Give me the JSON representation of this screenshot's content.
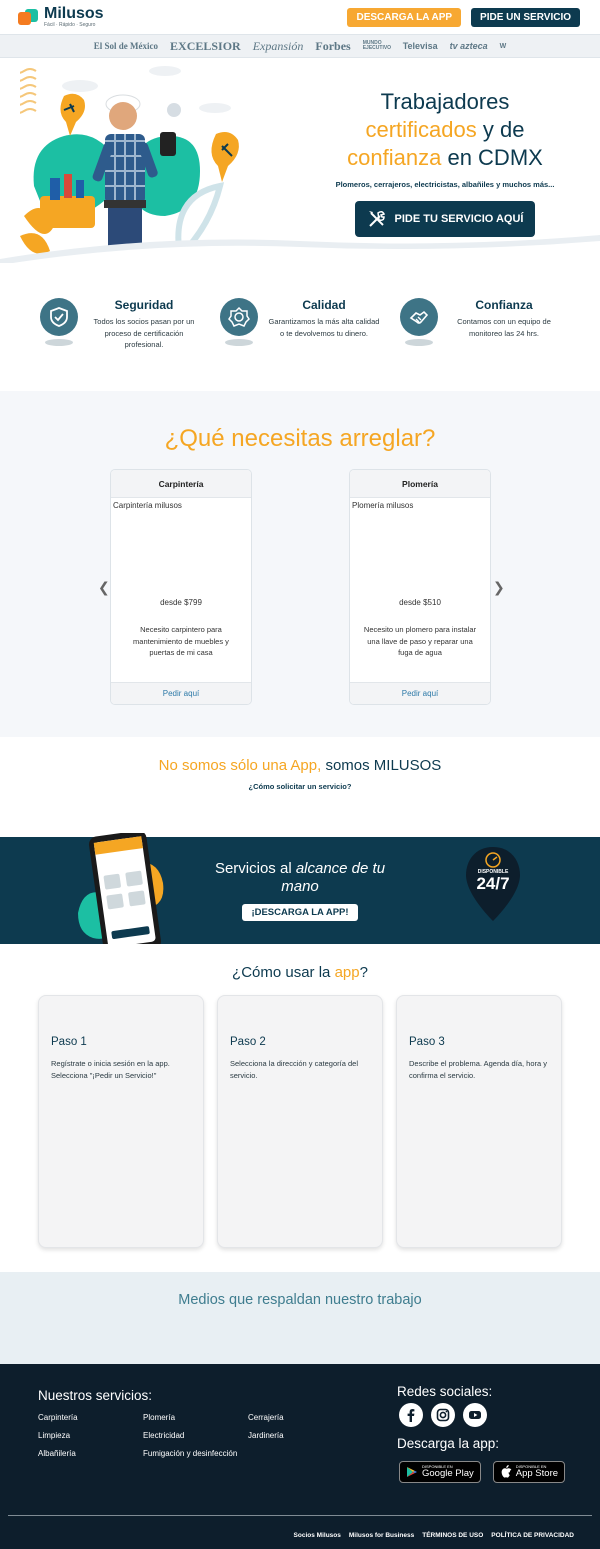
{
  "header": {
    "logo_name": "Milusos",
    "logo_tagline": "Fácil · Rápido · Seguro",
    "download_btn": "DESCARGA LA APP",
    "service_btn": "PIDE UN SERVICIO"
  },
  "press": [
    "El Sol de México",
    "EXCELSIOR",
    "Expansión",
    "Forbes",
    "MUNDO EJECUTIVO",
    "Televisa",
    "tv azteca",
    "W"
  ],
  "hero": {
    "title_1": "Trabajadores",
    "title_2a": "certificados",
    "title_2b": " y de",
    "title_3a": "confianza",
    "title_3b": " en CDMX",
    "subtitle": "Plomeros, cerrajeros, electricistas, albañiles y muchos más...",
    "cta": "PIDE TU SERVICIO AQUÍ"
  },
  "features": [
    {
      "title": "Seguridad",
      "desc": "Todos los socios pasan por un proceso de certificación profesional.",
      "icon": "shield-check-icon"
    },
    {
      "title": "Calidad",
      "desc": "Garantizamos la más alta calidad o te devolvemos tu dinero.",
      "icon": "quality-badge-icon"
    },
    {
      "title": "Confianza",
      "desc": "Contamos con un equipo de monitoreo las 24 hrs.",
      "icon": "handshake-icon"
    }
  ],
  "services": {
    "title": "¿Qué necesitas arreglar?",
    "cards": [
      {
        "title": "Carpintería",
        "img_alt": "Carpintería milusos",
        "price": "desde $799",
        "desc": "Necesito carpintero para mantenimiento de muebles y puertas de mi casa",
        "link": "Pedir aquí"
      },
      {
        "title": "Plomería",
        "img_alt": "Plomería milusos",
        "price": "desde $510",
        "desc": "Necesito un plomero para instalar una llave de paso y reparar una fuga de agua",
        "link": "Pedir aquí"
      }
    ]
  },
  "not_app": {
    "title_a": "No somos sólo una App,",
    "title_b": " somos MILUSOS",
    "link": "¿Cómo solicitar un servicio?"
  },
  "banner": {
    "title_a": "Servicios al ",
    "title_b": "alcance de tu mano",
    "button": "¡DESCARGA LA APP!",
    "badge_top": "DISPONIBLE",
    "badge_main": "24/7"
  },
  "how": {
    "title_a": "¿Cómo usar la ",
    "title_b": "app",
    "title_c": "?",
    "steps": [
      {
        "title": "Paso 1",
        "desc": "Regístrate o inicia sesión en la app. Selecciona \"¡Pedir un Servicio!\""
      },
      {
        "title": "Paso 2",
        "desc": "Selecciona la dirección y categoría del servicio."
      },
      {
        "title": "Paso 3",
        "desc": "Describe el problema. Agenda día, hora y confirma el servicio."
      }
    ]
  },
  "media": {
    "title": "Medios que respaldan nuestro trabajo"
  },
  "footer": {
    "services_title": "Nuestros servicios:",
    "services": [
      "Carpintería",
      "Plomería",
      "Cerrajería",
      "Limpieza",
      "Electricidad",
      "Jardinería",
      "Albañilería",
      "Fumigación y desinfección"
    ],
    "social_title": "Redes sociales:",
    "download_title": "Descarga la app:",
    "google_small": "DISPONIBLE EN",
    "google_big": "Google Play",
    "apple_small": "DISPONIBLE EN",
    "apple_big": "App Store",
    "links": [
      "Socios Milusos",
      "Milusos for Business",
      "TÉRMINOS DE USO",
      "POLÍTICA DE PRIVACIDAD"
    ]
  },
  "colors": {
    "brand_dark": "#0d3a4f",
    "accent": "#f5a623",
    "teal": "#1cbfa3",
    "footer_bg": "#0d1e2c"
  }
}
